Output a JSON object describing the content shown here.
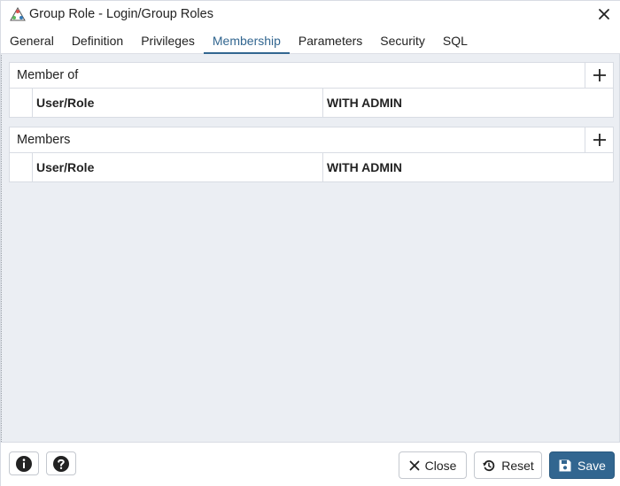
{
  "window": {
    "title": "Group Role - Login/Group Roles",
    "app_icon": "pgadmin-group-role-icon",
    "close_icon": "close-icon"
  },
  "tabs": [
    {
      "label": "General",
      "active": false
    },
    {
      "label": "Definition",
      "active": false
    },
    {
      "label": "Privileges",
      "active": false
    },
    {
      "label": "Membership",
      "active": true
    },
    {
      "label": "Parameters",
      "active": false
    },
    {
      "label": "Security",
      "active": false
    },
    {
      "label": "SQL",
      "active": false
    }
  ],
  "member_of": {
    "title": "Member of",
    "add_icon": "plus-icon",
    "columns": [
      "User/Role",
      "WITH ADMIN"
    ],
    "rows": []
  },
  "members": {
    "title": "Members",
    "add_icon": "plus-icon",
    "columns": [
      "User/Role",
      "WITH ADMIN"
    ],
    "rows": []
  },
  "footer": {
    "info_icon": "info-icon",
    "help_icon": "help-icon",
    "close_label": "Close",
    "reset_label": "Reset",
    "save_label": "Save"
  },
  "colors": {
    "accent": "#326690",
    "background": "#ebeef3",
    "border": "#d8dce3"
  }
}
